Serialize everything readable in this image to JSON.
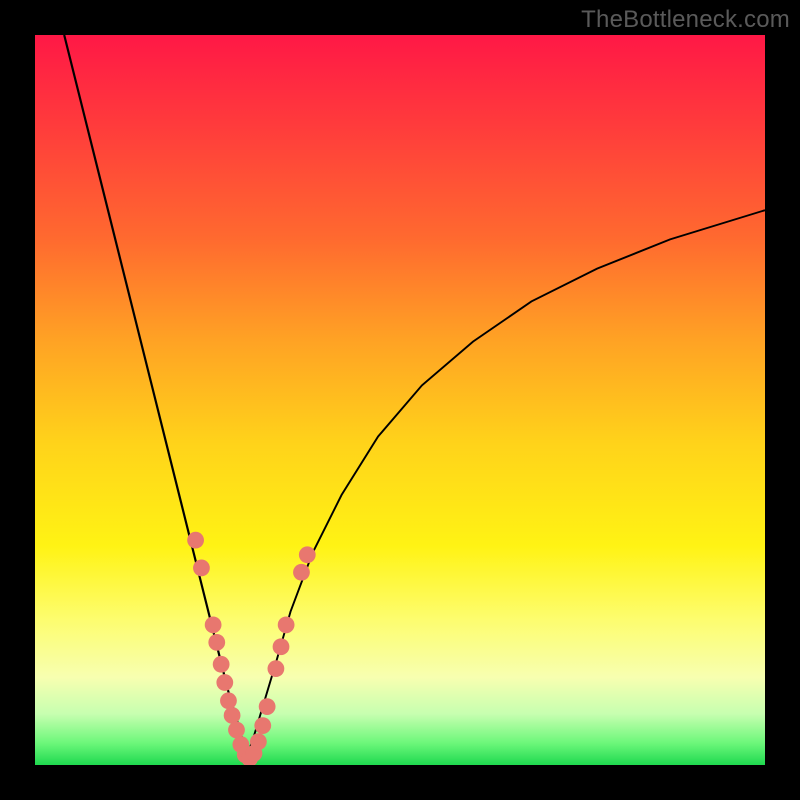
{
  "watermark": "TheBottleneck.com",
  "chart_data": {
    "type": "line",
    "title": "",
    "xlabel": "",
    "ylabel": "",
    "xlim": [
      0,
      100
    ],
    "ylim": [
      0,
      100
    ],
    "series": [
      {
        "name": "left-branch",
        "x": [
          4,
          6,
          8,
          10,
          12,
          14,
          16,
          18,
          20,
          22,
          23.5,
          25,
          26.5,
          28,
          29
        ],
        "y": [
          100,
          92,
          84,
          76,
          68,
          60,
          52,
          44,
          36,
          28,
          22,
          16,
          10,
          5,
          1
        ]
      },
      {
        "name": "right-branch",
        "x": [
          29,
          30,
          31.5,
          33,
          35,
          38,
          42,
          47,
          53,
          60,
          68,
          77,
          87,
          100
        ],
        "y": [
          1,
          4,
          9,
          14,
          21,
          29,
          37,
          45,
          52,
          58,
          63.5,
          68,
          72,
          76
        ]
      }
    ],
    "markers": {
      "name": "highlight-points",
      "color": "#e8776f",
      "radius_pct": 1.15,
      "points": [
        {
          "x": 22.0,
          "y": 30.8
        },
        {
          "x": 22.8,
          "y": 27.0
        },
        {
          "x": 24.4,
          "y": 19.2
        },
        {
          "x": 24.9,
          "y": 16.8
        },
        {
          "x": 25.5,
          "y": 13.8
        },
        {
          "x": 26.0,
          "y": 11.3
        },
        {
          "x": 26.5,
          "y": 8.8
        },
        {
          "x": 27.0,
          "y": 6.8
        },
        {
          "x": 27.6,
          "y": 4.8
        },
        {
          "x": 28.2,
          "y": 2.8
        },
        {
          "x": 28.8,
          "y": 1.4
        },
        {
          "x": 29.4,
          "y": 0.9
        },
        {
          "x": 30.0,
          "y": 1.6
        },
        {
          "x": 30.6,
          "y": 3.2
        },
        {
          "x": 31.2,
          "y": 5.4
        },
        {
          "x": 31.8,
          "y": 8.0
        },
        {
          "x": 33.0,
          "y": 13.2
        },
        {
          "x": 33.7,
          "y": 16.2
        },
        {
          "x": 34.4,
          "y": 19.2
        },
        {
          "x": 36.5,
          "y": 26.4
        },
        {
          "x": 37.3,
          "y": 28.8
        }
      ]
    }
  }
}
